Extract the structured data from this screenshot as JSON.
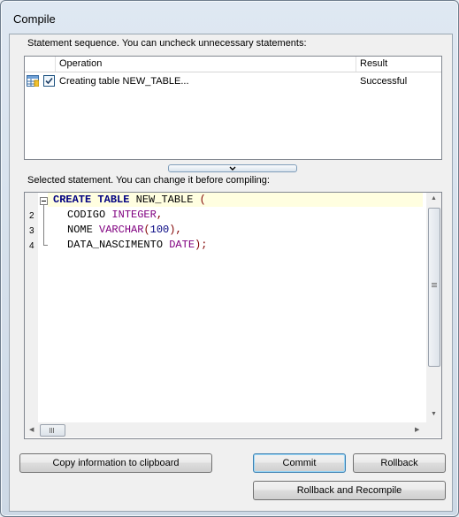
{
  "window": {
    "title": "Compile"
  },
  "sequence": {
    "label": "Statement sequence. You can uncheck unnecessary statements:",
    "columns": {
      "operation": "Operation",
      "result": "Result"
    },
    "rows": [
      {
        "checked": true,
        "icon": "table-icon",
        "operation": "Creating table NEW_TABLE...",
        "result": "Successful"
      }
    ]
  },
  "statement": {
    "label": "Selected statement. You can change it before compiling:",
    "line_numbers": [
      "2",
      "3",
      "4"
    ],
    "code": {
      "l1": {
        "kw1": "CREATE",
        "kw2": "TABLE",
        "name": "NEW_TABLE",
        "paren": "("
      },
      "l2": {
        "col": "CODIGO",
        "type": "INTEGER",
        "punct": ","
      },
      "l3": {
        "col": "NOME",
        "type": "VARCHAR",
        "open": "(",
        "num": "100",
        "close": ")",
        "punct": ","
      },
      "l4": {
        "col": "DATA_NASCIMENTO",
        "type": "DATE",
        "close": ")",
        "punct": ";"
      }
    }
  },
  "buttons": {
    "copy": "Copy information to clipboard",
    "commit": "Commit",
    "rollback": "Rollback",
    "rollback_recompile": "Rollback and Recompile"
  }
}
